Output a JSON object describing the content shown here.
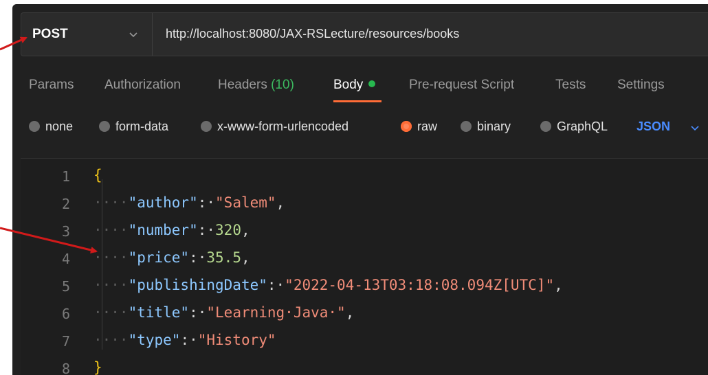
{
  "request": {
    "method": "POST",
    "url": "http://localhost:8080/JAX-RSLecture/resources/books"
  },
  "tabs": [
    {
      "label": "Params"
    },
    {
      "label": "Authorization"
    },
    {
      "label": "Headers",
      "count": "(10)"
    },
    {
      "label": "Body",
      "active": true
    },
    {
      "label": "Pre-request Script"
    },
    {
      "label": "Tests"
    },
    {
      "label": "Settings"
    }
  ],
  "body_types": {
    "options": [
      "none",
      "form-data",
      "x-www-form-urlencoded",
      "raw",
      "binary",
      "GraphQL"
    ],
    "selected": "raw",
    "format": "JSON"
  },
  "editor": {
    "line_numbers": [
      "1",
      "2",
      "3",
      "4",
      "5",
      "6",
      "7",
      "8"
    ],
    "lines": [
      {
        "open": "{"
      },
      {
        "key": "\"author\"",
        "value": "\"Salem\"",
        "type": "string",
        "comma": ","
      },
      {
        "key": "\"number\"",
        "value": "320",
        "type": "number",
        "comma": ","
      },
      {
        "key": "\"price\"",
        "value": "35.5",
        "type": "number",
        "comma": ","
      },
      {
        "key": "\"publishingDate\"",
        "value": "\"2022-04-13T03:18:08.094Z[UTC]\"",
        "type": "string",
        "comma": ","
      },
      {
        "key": "\"title\"",
        "value": "\"Learning·Java·\"",
        "type": "string",
        "comma": ","
      },
      {
        "key": "\"type\"",
        "value": "\"History\"",
        "type": "string",
        "comma": ""
      },
      {
        "close": "}"
      }
    ]
  },
  "colors": {
    "accent": "#ff6c37",
    "annotation_arrow": "#d11a1a",
    "json_key": "#8dc8ff",
    "json_string": "#f08c78",
    "json_number": "#b5d78e"
  }
}
